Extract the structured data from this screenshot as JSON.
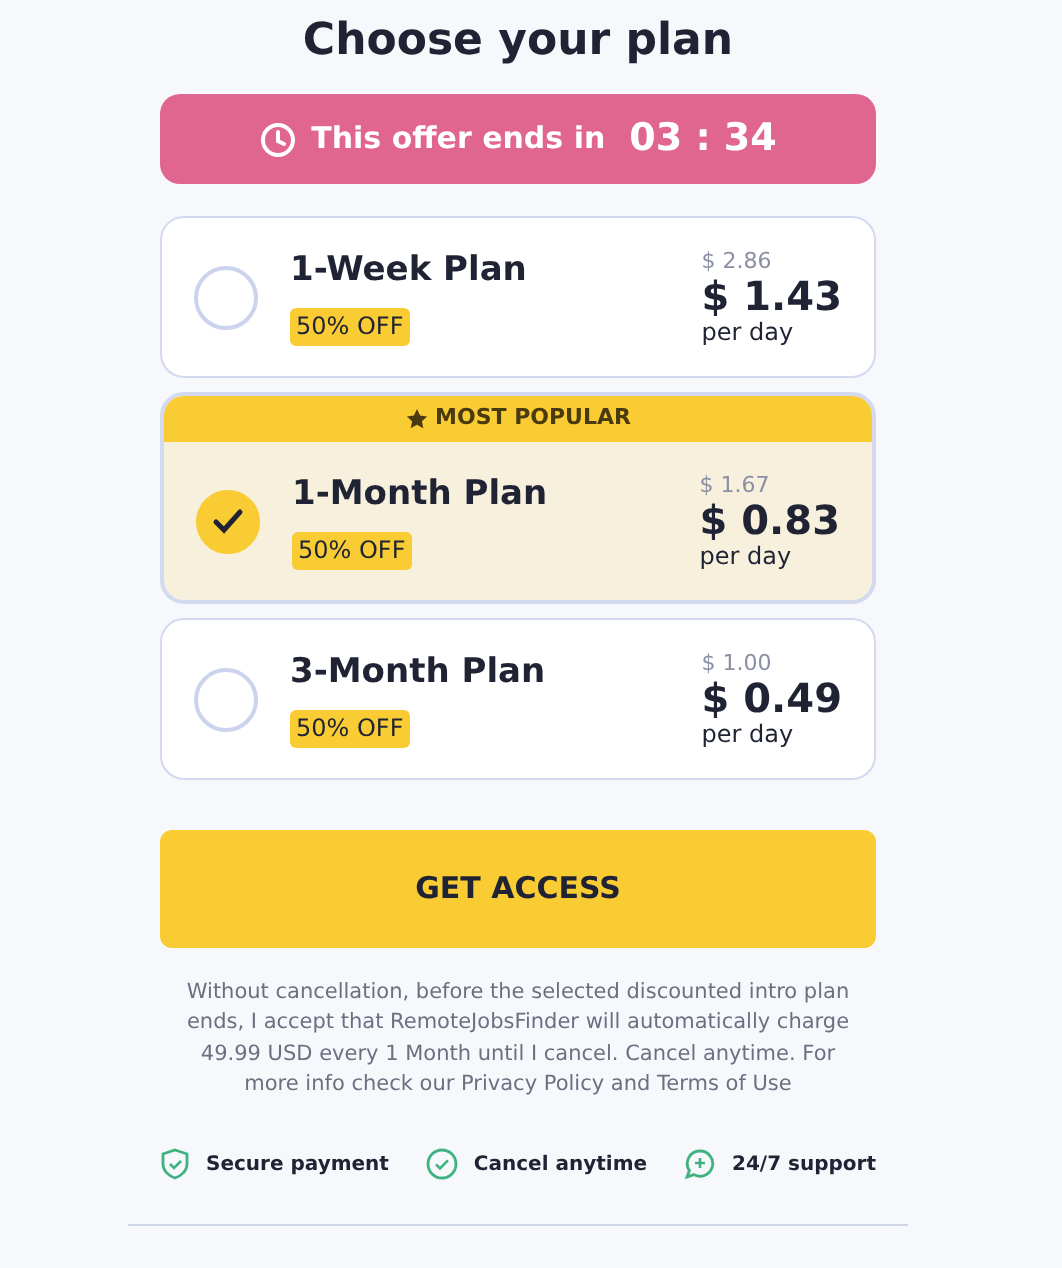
{
  "title": "Choose your plan",
  "timer": {
    "label": "This offer ends in",
    "time": "03 : 34"
  },
  "plans": [
    {
      "name": "1-Week Plan",
      "badge": "50% OFF",
      "old_price": "$ 2.86",
      "price": "$ 1.43",
      "unit": "per day",
      "selected": false
    },
    {
      "name": "1-Month Plan",
      "badge": "50% OFF",
      "old_price": "$ 1.67",
      "price": "$ 0.83",
      "unit": "per day",
      "selected": true,
      "ribbon": "MOST POPULAR"
    },
    {
      "name": "3-Month Plan",
      "badge": "50% OFF",
      "old_price": "$ 1.00",
      "price": "$ 0.49",
      "unit": "per day",
      "selected": false
    }
  ],
  "cta": "GET ACCESS",
  "disclaimer": "Without cancellation, before the selected discounted intro plan ends, I accept that RemoteJobsFinder will automatically charge 49.99 USD every 1 Month until I cancel. Cancel anytime. For more info check our Privacy Policy and Terms of Use",
  "features": [
    {
      "kind": "shield",
      "label": "Secure payment"
    },
    {
      "kind": "check",
      "label": "Cancel anytime"
    },
    {
      "kind": "chat",
      "label": "24/7 support"
    }
  ]
}
